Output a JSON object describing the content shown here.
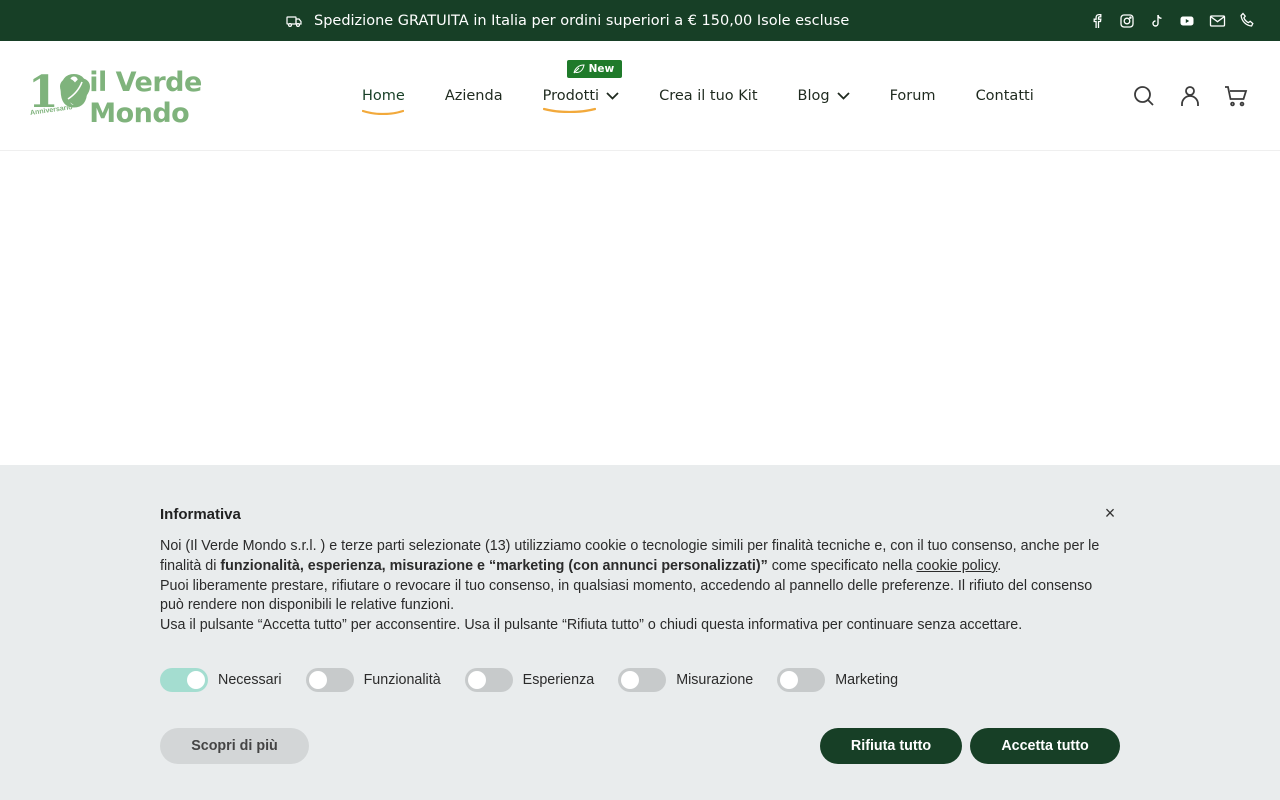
{
  "announcement": {
    "text": "Spedizione GRATUITA in Italia per ordini superiori a € 150,00 Isole escluse",
    "icon": "truck-icon"
  },
  "social": [
    {
      "name": "facebook-icon"
    },
    {
      "name": "instagram-icon"
    },
    {
      "name": "tiktok-icon"
    },
    {
      "name": "youtube-icon"
    },
    {
      "name": "mail-icon"
    },
    {
      "name": "phone-icon"
    }
  ],
  "logo": {
    "number": "10",
    "tagline": "Anniversario",
    "brand": "il Verde Mondo"
  },
  "nav": {
    "items": [
      {
        "label": "Home",
        "active": true
      },
      {
        "label": "Azienda"
      },
      {
        "label": "Prodotti",
        "badge": "New",
        "dropdown": true
      },
      {
        "label": "Crea il tuo Kit"
      },
      {
        "label": "Blog",
        "dropdown": true
      },
      {
        "label": "Forum"
      },
      {
        "label": "Contatti"
      }
    ]
  },
  "cookie": {
    "title": "Informativa",
    "close": "×",
    "p1_a": "Noi (Il Verde Mondo s.r.l. ) e terze parti selezionate (13) utilizziamo cookie o tecnologie simili per finalità tecniche e, con il tuo consenso, anche per le finalità di ",
    "p1_b": "funzionalità, esperienza, misurazione e “marketing (con annunci personalizzati)”",
    "p1_c": " come specificato nella ",
    "p1_link": "cookie policy",
    "p1_d": ".",
    "p2": "Puoi liberamente prestare, rifiutare o revocare il tuo consenso, in qualsiasi momento, accedendo al pannello delle preferenze. Il rifiuto del consenso può rendere non disponibili le relative funzioni.",
    "p3": "Usa il pulsante “Accetta tutto” per acconsentire. Usa il pulsante “Rifiuta tutto” o chiudi questa informativa per continuare senza accettare.",
    "toggles": [
      {
        "label": "Necessari",
        "on": true
      },
      {
        "label": "Funzionalità",
        "on": false
      },
      {
        "label": "Esperienza",
        "on": false
      },
      {
        "label": "Misurazione",
        "on": false
      },
      {
        "label": "Marketing",
        "on": false
      }
    ],
    "more_label": "Scopri di più",
    "reject_label": "Rifiuta tutto",
    "accept_label": "Accetta tutto"
  },
  "colors": {
    "topbar_bg": "#173f26",
    "brand_green": "#7fb37c",
    "accent_orange": "#f2a93b",
    "badge_green": "#1f7a2a",
    "toggle_on": "#a4ddd0"
  }
}
